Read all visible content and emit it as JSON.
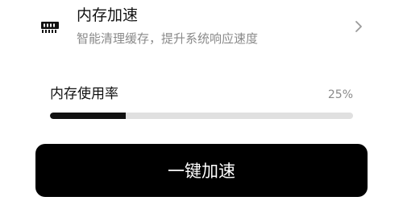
{
  "feature": {
    "icon": "memory-chip-icon",
    "title": "内存加速",
    "description": "智能清理缓存，提升系统响应速度",
    "chevron_icon": "chevron-right-icon"
  },
  "memory_usage": {
    "label": "内存使用率",
    "percent_text": "25%",
    "percent_value": 25
  },
  "action": {
    "boost_label": "一键加速"
  },
  "colors": {
    "accent": "#000000",
    "track": "#e0e0e0",
    "secondary_text": "#8a8a8a"
  }
}
